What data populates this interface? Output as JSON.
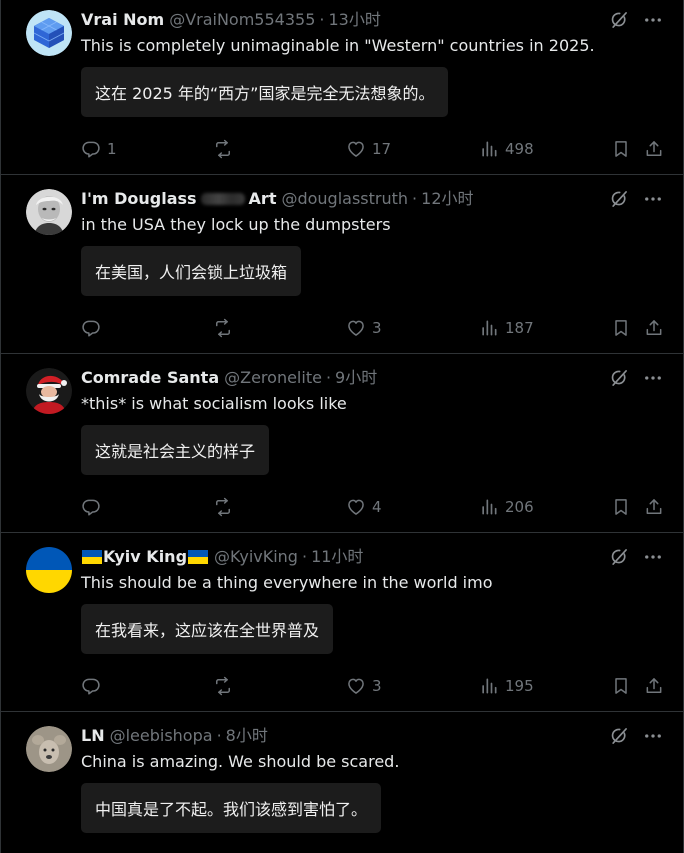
{
  "tweets": [
    {
      "name": "Vrai Nom",
      "handle": "@VraiNom554355",
      "time": "13小时",
      "text": "This is completely unimaginable in \"Western\" countries in 2025.",
      "translation": "这在 2025 年的“西方”国家是完全无法想象的。",
      "replies": "1",
      "reposts": "",
      "likes": "17",
      "views": "498"
    },
    {
      "name_prefix": "I'm Douglass",
      "name_suffix": "Art",
      "handle": "@douglasstruth",
      "time": "12小时",
      "text": "in the USA they lock up the dumpsters",
      "translation": "在美国，人们会锁上垃圾箱",
      "replies": "",
      "reposts": "",
      "likes": "3",
      "views": "187"
    },
    {
      "name": "Comrade Santa",
      "handle": "@Zeronelite",
      "time": "9小时",
      "text": "*this* is what socialism looks like",
      "translation": "这就是社会主义的样子",
      "replies": "",
      "reposts": "",
      "likes": "4",
      "views": "206"
    },
    {
      "name": "Kyiv King",
      "handle": "@KyivKing",
      "time": "11小时",
      "text": "This should be a thing everywhere in the world imo",
      "translation": "在我看来，这应该在全世界普及",
      "replies": "",
      "reposts": "",
      "likes": "3",
      "views": "195"
    },
    {
      "name": "LN",
      "handle": "@leebishopa",
      "time": "8小时",
      "text": "China is amazing. We should be scared.",
      "translation": "中国真是了不起。我们该感到害怕了。"
    }
  ],
  "separator": "·",
  "icons": {
    "reply": "reply-icon",
    "repost": "repost-icon",
    "like": "heart-icon",
    "views": "views-icon",
    "bookmark": "bookmark-icon",
    "share": "share-icon",
    "grok": "grok-icon",
    "more": "more-icon"
  },
  "colors": {
    "background": "#000000",
    "text": "#e7e9ea",
    "muted": "#71767b",
    "divider": "#2f3336",
    "translation_box": "#1c1c1c",
    "ukraine_blue": "#0057b7",
    "ukraine_yellow": "#ffd700"
  }
}
